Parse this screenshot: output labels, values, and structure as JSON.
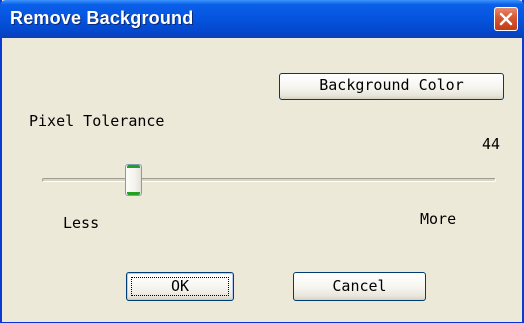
{
  "window": {
    "title": "Remove Background",
    "close_icon": "close-icon",
    "title_color": "#ffffff",
    "titlebar_color": "#0655e0",
    "close_button_color": "#d65a35",
    "body_color": "#ece9d8"
  },
  "toolbar": {
    "background_color_label": "Background Color"
  },
  "tolerance": {
    "label": "Pixel Tolerance",
    "value": "44",
    "min_label": "Less",
    "max_label": "More",
    "slider_fraction": 0.19,
    "thumb_accent_color": "#21a121"
  },
  "actions": {
    "ok_label": "OK",
    "cancel_label": "Cancel"
  }
}
